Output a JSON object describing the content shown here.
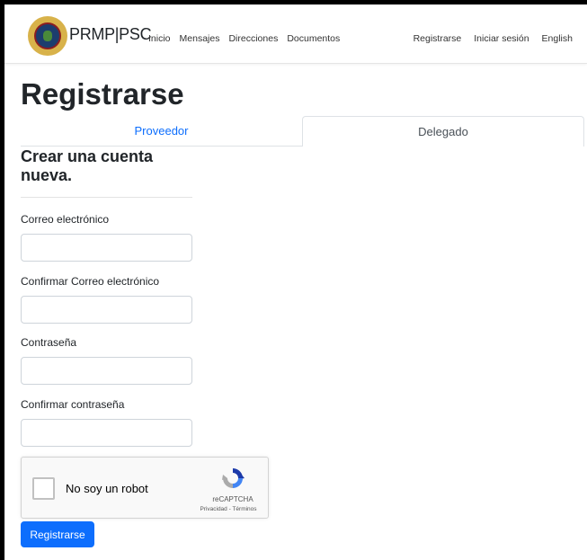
{
  "colors": {
    "primary": "#0d6efd",
    "text": "#212529"
  },
  "navbar": {
    "brand": "PRMP|PSC",
    "seal_icon": "puerto-rico-seal-icon",
    "left_links": [
      "Inicio",
      "Mensajes",
      "Direcciones",
      "Documentos"
    ],
    "right_links": [
      "Registrarse",
      "Iniciar sesión",
      "English"
    ]
  },
  "page": {
    "title": "Registrarse"
  },
  "tabs": [
    {
      "label": "Proveedor",
      "active": false
    },
    {
      "label": "Delegado",
      "active": true
    }
  ],
  "form": {
    "subtitle": "Crear una cuenta nueva.",
    "fields": [
      {
        "label": "Correo electrónico",
        "value": ""
      },
      {
        "label": "Confirmar Correo electrónico",
        "value": ""
      },
      {
        "label": "Contraseña",
        "value": ""
      },
      {
        "label": "Confirmar contraseña",
        "value": ""
      }
    ],
    "captcha": {
      "label": "No soy un robot",
      "brand": "reCAPTCHA",
      "links": "Privacidad - Términos",
      "checked": false
    },
    "submit_label": "Registrarse"
  }
}
